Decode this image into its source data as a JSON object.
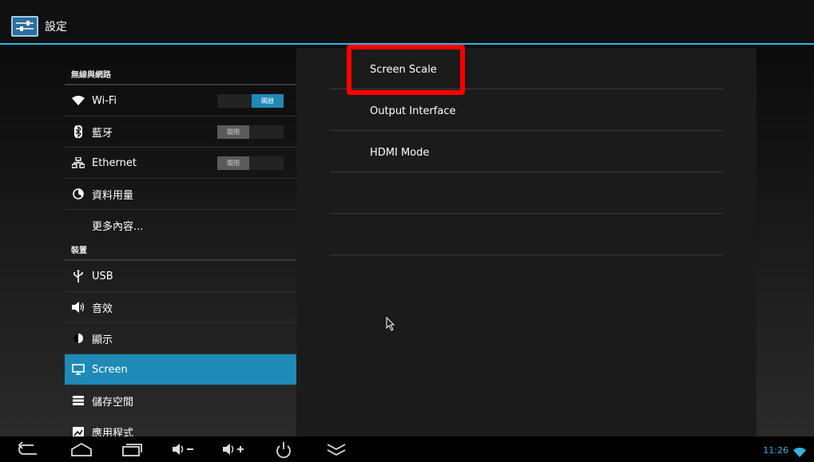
{
  "app": {
    "title": "設定"
  },
  "sidebar": {
    "sections": [
      {
        "header": "無線與網路"
      },
      {
        "header": "裝置"
      }
    ],
    "wireless_items": [
      {
        "label": "Wi-Fi",
        "icon": "wifi-icon",
        "toggle": "開啟",
        "toggle_state": "on"
      },
      {
        "label": "藍牙",
        "icon": "bluetooth-icon",
        "toggle": "關閉",
        "toggle_state": "off"
      },
      {
        "label": "Ethernet",
        "icon": "ethernet-icon",
        "toggle": "關閉",
        "toggle_state": "off"
      },
      {
        "label": "資料用量",
        "icon": "data-usage-icon"
      },
      {
        "label": "更多內容..."
      }
    ],
    "device_items": [
      {
        "label": "USB",
        "icon": "usb-icon"
      },
      {
        "label": "音效",
        "icon": "sound-icon"
      },
      {
        "label": "顯示",
        "icon": "display-icon"
      },
      {
        "label": "Screen",
        "icon": "screen-icon",
        "selected": true
      },
      {
        "label": "儲存空間",
        "icon": "storage-icon"
      },
      {
        "label": "應用程式",
        "icon": "apps-icon"
      }
    ]
  },
  "main": {
    "options": [
      "Screen Scale",
      "Output Interface",
      "HDMI Mode",
      "",
      ""
    ]
  },
  "navbar": {
    "buttons": [
      "back-icon",
      "home-icon",
      "recent-apps-icon",
      "volume-down-icon",
      "volume-up-icon",
      "power-icon",
      "hide-bar-icon"
    ],
    "clock": "11:26"
  },
  "colors": {
    "accent": "#33b5e5",
    "selected": "#1f89b8",
    "highlight": "#ff0000"
  }
}
